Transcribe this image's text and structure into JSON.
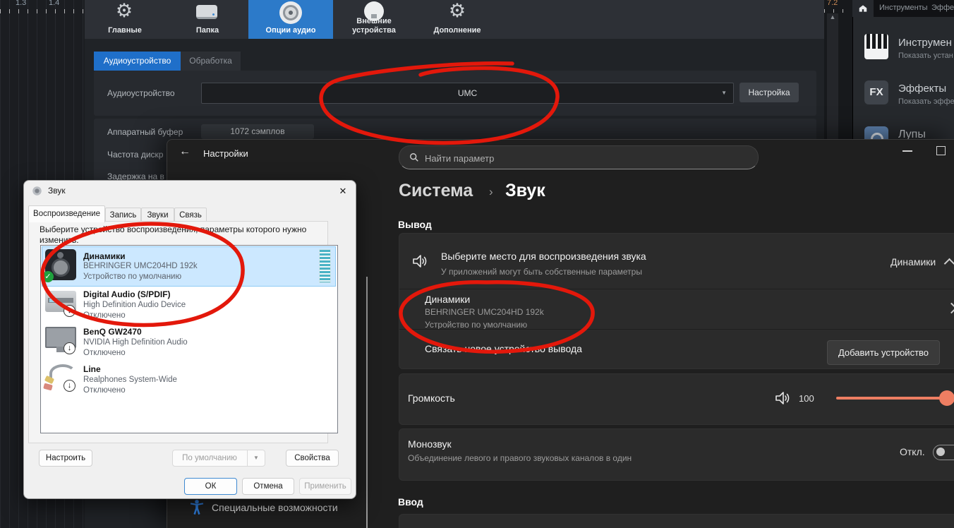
{
  "daw": {
    "timeline": {
      "mark_1": "1.3",
      "mark_2": "1.4",
      "mark_right": "7.2"
    },
    "toolbar": {
      "main_label": "Главные",
      "folder_label": "Папка",
      "audio_options_label": "Опции аудио",
      "external_label": "Внешние устройства",
      "addons_label": "Дополнение"
    },
    "audio_panel": {
      "tab_device": "Аудиоустройство",
      "tab_processing": "Обработка",
      "device_label": "Аудиоустройство",
      "device_value": "UMC",
      "configure_button": "Настройка",
      "buffer_label": "Аппаратный буфер",
      "buffer_value": "1072 сэмплов",
      "sample_rate_label": "Частота дискр",
      "latency_label": "Задержка на в"
    },
    "browser": {
      "tab_instruments": "Инструменты",
      "tab_effects": "Эффек",
      "item1_title": "Инструмен",
      "item1_sub": "Показать устан",
      "item2_title": "Эффекты",
      "item2_sub": "Показать эффе",
      "item3_title": "Лупы"
    }
  },
  "settings": {
    "title": "Настройки",
    "search_placeholder": "Найти параметр",
    "breadcrumb": {
      "parent": "Система",
      "current": "Звук"
    },
    "output_section": "Вывод",
    "output_picker": {
      "title": "Выберите место для воспроизведения звука",
      "subtitle": "У приложений могут быть собственные параметры",
      "value": "Динамики"
    },
    "device": {
      "name": "Динамики",
      "desc": "BEHRINGER UMC204HD 192k",
      "status": "Устройство по умолчанию"
    },
    "pair_row": {
      "label": "Связать новое устройство вывода",
      "button": "Добавить устройство"
    },
    "volume_row": {
      "label": "Громкость",
      "value": "100"
    },
    "mono_row": {
      "label": "Монозвук",
      "subtitle": "Объединение левого и правого звуковых каналов в один",
      "state": "Откл."
    },
    "input_section": "Ввод",
    "nav_bottom": "Специальные возможности"
  },
  "sound_dialog": {
    "title": "Звук",
    "tabs": {
      "playback": "Воспроизведение",
      "recording": "Запись",
      "sounds": "Звуки",
      "communication": "Связь"
    },
    "instruction": "Выберите устройство воспроизведения, параметры которого нужно изменить:",
    "devices": [
      {
        "name": "Динамики",
        "desc": "BEHRINGER UMC204HD 192k",
        "status": "Устройство по умолчанию"
      },
      {
        "name": "Digital Audio (S/PDIF)",
        "desc": "High Definition Audio Device",
        "status": "Отключено"
      },
      {
        "name": "BenQ GW2470",
        "desc": "NVIDIA High Definition Audio",
        "status": "Отключено"
      },
      {
        "name": "Line",
        "desc": "Realphones System-Wide",
        "status": "Отключено"
      }
    ],
    "buttons": {
      "configure": "Настроить",
      "set_default": "По умолчанию",
      "properties": "Свойства",
      "ok": "ОК",
      "cancel": "Отмена",
      "apply": "Применить"
    }
  },
  "glyphs": {
    "gear": "⚙",
    "dropdown": "▼",
    "scroll_up": "▲",
    "close": "✕",
    "check": "✓",
    "down": "↓",
    "crumb_sep": "›",
    "back": "←",
    "fx": "FX"
  },
  "colors": {
    "toolbar_selected": "#2c7ac9",
    "tab_selected": "#1f6fc9",
    "slider_accent": "#ee7e62",
    "annotation_red": "#e3180b",
    "selection_blue": "#cce8ff",
    "meter_teal": "#4ab3c5"
  }
}
